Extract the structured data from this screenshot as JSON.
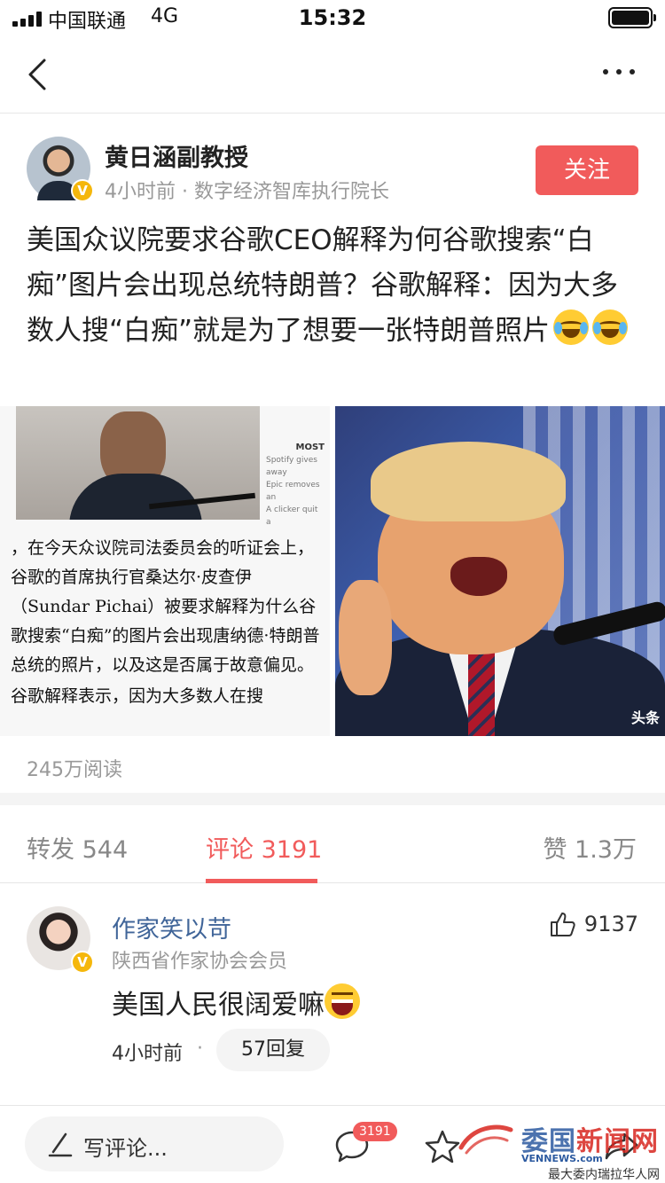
{
  "status_bar": {
    "carrier": "中国联通",
    "network": "4G",
    "time": "15:32"
  },
  "author": {
    "name": "黄日涵副教授",
    "time_ago": "4小时前",
    "title": "数字经济智库执行院长",
    "follow_label": "关注",
    "verified": "V"
  },
  "post": {
    "text": "美国众议院要求谷歌CEO解释为何谷歌搜索“白痴”图片会出现总统特朗普？谷歌解释：因为大多数人搜“白痴”就是为了想要一张特朗普照片",
    "emoji_icons": [
      "crying-laughing-emoji-icon",
      "crying-laughing-emoji-icon"
    ],
    "image_left": {
      "caption": "，在今天众议院司法委员会的听证会上，谷歌的首席执行官桑达尔·皮查伊（Sundar Pichai）被要求解释为什么谷歌搜索“白痴”的图片会出现唐纳德·特朗普总统的照片，以及这是否属于故意偏见。",
      "caption_cut": "谷歌解释表示，因为大多数人在搜",
      "side_label": "MOST",
      "side_lines": [
        "Spotify gives away",
        "Epic removes an",
        "A clicker quit a"
      ]
    },
    "image_right": {
      "watermark": "头条"
    },
    "read_count": "245万阅读"
  },
  "tabs": {
    "repost": "转发 544",
    "comments": "评论 3191",
    "likes": "赞 1.3万"
  },
  "comment": {
    "name": "作家笑以苛",
    "meta": "陕西省作家协会会员",
    "likes": "9137",
    "text": "美国人民很阔爱嘛",
    "time_ago": "4小时前",
    "dot": "·",
    "replies": "57回复"
  },
  "bottom_bar": {
    "compose_placeholder": "写评论...",
    "comment_count": "3191"
  },
  "site_watermark": {
    "title_a": "委国",
    "title_b": "新闻网",
    "domain": "VENNEWS.com",
    "subtitle": "最大委内瑞拉华人网"
  },
  "colors": {
    "accent": "#f15b5b",
    "link": "#406599",
    "muted": "#999999"
  }
}
